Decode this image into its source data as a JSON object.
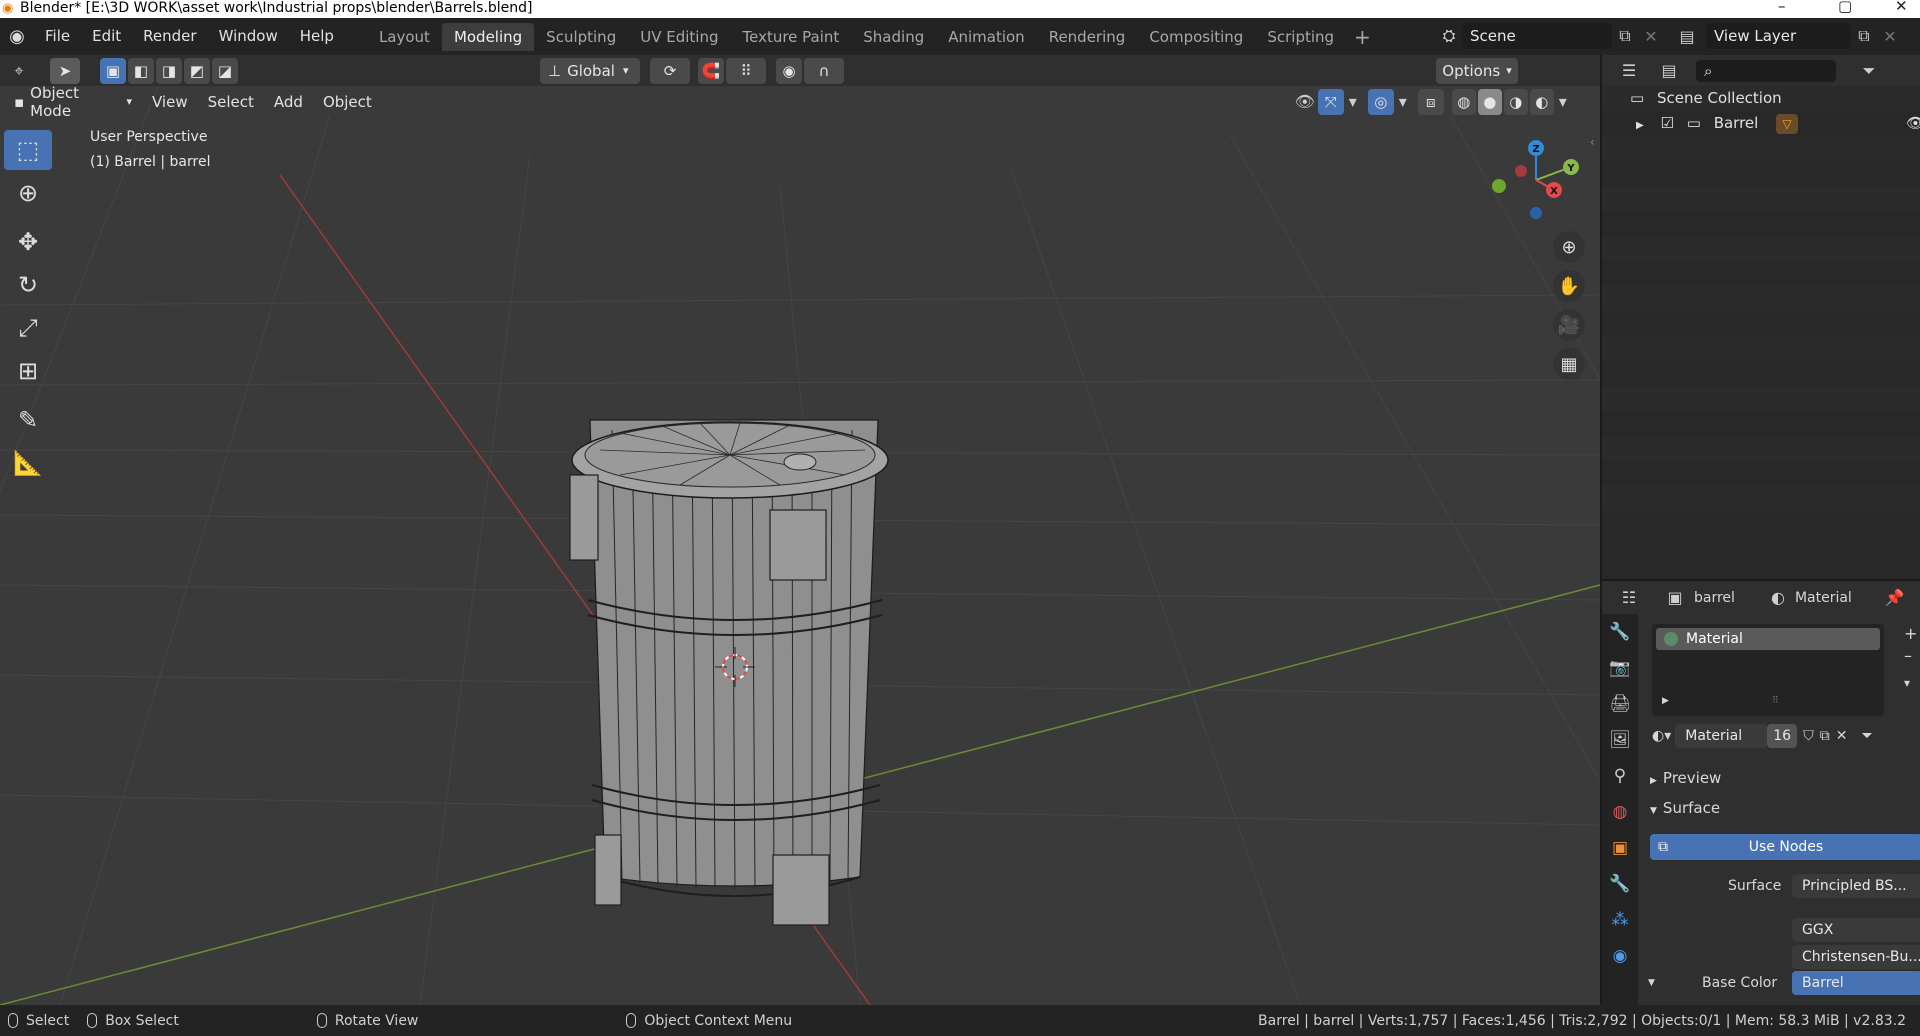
{
  "window": {
    "title": "Blender* [E:\\3D WORK\\asset work\\Industrial props\\blender\\Barrels.blend]"
  },
  "menu": [
    "File",
    "Edit",
    "Render",
    "Window",
    "Help"
  ],
  "workspaces": {
    "tabs": [
      "Layout",
      "Modeling",
      "Sculpting",
      "UV Editing",
      "Texture Paint",
      "Shading",
      "Animation",
      "Rendering",
      "Compositing",
      "Scripting"
    ],
    "active": "Modeling"
  },
  "scene": {
    "name": "Scene",
    "view_layer": "View Layer"
  },
  "viewport": {
    "transform_orientation": "Global",
    "options_label": "Options",
    "mode": "Object Mode",
    "menus": [
      "View",
      "Select",
      "Add",
      "Object"
    ],
    "info_line1": "User Perspective",
    "info_line2": "(1) Barrel | barrel",
    "gizmo_axes": {
      "z": "Z",
      "y": "Y",
      "x": "X"
    }
  },
  "outliner": {
    "root": "Scene Collection",
    "items": [
      {
        "name": "Barrel"
      }
    ]
  },
  "properties": {
    "object_name": "barrel",
    "material_tab": "Material",
    "slot_name": "Material",
    "datablock_name": "Material",
    "user_count": "16",
    "preview_label": "Preview",
    "surface_label": "Surface",
    "use_nodes_label": "Use Nodes",
    "surface_field_label": "Surface",
    "surface_value": "Principled BS...",
    "distribution": "GGX",
    "subsurface_method": "Christensen-Bu...",
    "base_color_label": "Base Color",
    "base_color_value": "Barrel"
  },
  "statusbar": {
    "select": "Select",
    "box_select": "Box Select",
    "rotate_view": "Rotate View",
    "context_menu": "Object Context Menu",
    "stats": "Barrel | barrel | Verts:1,757 | Faces:1,456 | Tris:2,792 | Objects:0/1 | Mem: 58.3 MiB | v2.83.2"
  },
  "colors": {
    "accent_blue": "#4772b3",
    "viewport_bg": "#3a3a3a",
    "x_axis": "#e04a4a",
    "y_axis": "#8cb84a",
    "z_axis": "#2f8bd8"
  }
}
